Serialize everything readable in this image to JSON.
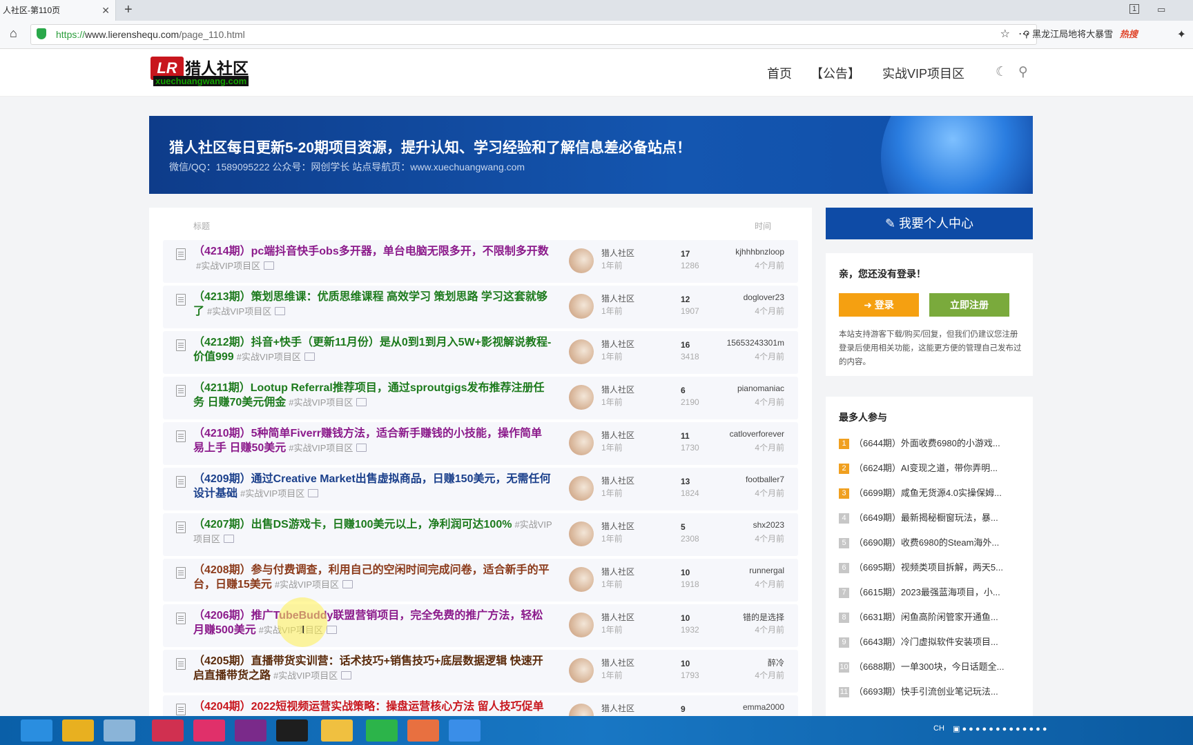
{
  "browser": {
    "tab_title": "人社区-第110页",
    "tab_close": "✕",
    "new_tab": "+",
    "url_scheme": "https://",
    "url_host": "www.lierenshequ.com",
    "url_path": "/page_110.html",
    "search_hint": "黑龙江局地将大暴雪",
    "search_hot": "热搜",
    "win_ctl_1": "1"
  },
  "site": {
    "logo_mark": "LR",
    "logo_name": "猎人社区",
    "logo_domain": "xuechuangwang.com",
    "nav": [
      "首页",
      "【公告】",
      "实战VIP项目区"
    ]
  },
  "banner": {
    "headline": "猎人社区每日更新5-20期项目资源，提升认知、学习经验和了解信息差必备站点！",
    "subline": "微信/QQ：1589095222 公众号：网创学长 站点导航页：www.xuechuangwang.com"
  },
  "list": {
    "col_title": "标题",
    "col_time": "时间",
    "rows": [
      {
        "title": "（4214期）pc端抖音快手obs多开器，单台电脑无限多开，不限制多开数",
        "category": "#实战VIP项目区",
        "color": "#8b1a8b",
        "author": "猎人社区",
        "ago": "1年前",
        "replies": "17",
        "views": "1286",
        "last_user": "kjhhhbnzloop",
        "last_ago": "4个月前"
      },
      {
        "title": "（4213期）策划思维课：优质思维课程 高效学习 策划思路 学习这套就够了",
        "category": "#实战VIP项目区",
        "color": "#1c7a1c",
        "author": "猎人社区",
        "ago": "1年前",
        "replies": "12",
        "views": "1907",
        "last_user": "doglover23",
        "last_ago": "4个月前"
      },
      {
        "title": "（4212期）抖音+快手（更新11月份）是从0到1到月入5W+影视解说教程-价值999",
        "category": "#实战VIP项目区",
        "color": "#1c7a1c",
        "author": "猎人社区",
        "ago": "1年前",
        "replies": "16",
        "views": "3418",
        "last_user": "15653243301m",
        "last_ago": "4个月前"
      },
      {
        "title": "（4211期）Lootup Referral推荐项目，通过sproutgigs发布推荐注册任务 日赚70美元佣金",
        "category": "#实战VIP项目区",
        "color": "#1c7a1c",
        "author": "猎人社区",
        "ago": "1年前",
        "replies": "6",
        "views": "2190",
        "last_user": "pianomaniac",
        "last_ago": "4个月前"
      },
      {
        "title": "（4210期）5种简单Fiverr赚钱方法，适合新手赚钱的小技能，操作简单易上手 日赚50美元",
        "category": "#实战VIP项目区",
        "color": "#8b1a8b",
        "author": "猎人社区",
        "ago": "1年前",
        "replies": "11",
        "views": "1730",
        "last_user": "catloverforever",
        "last_ago": "4个月前"
      },
      {
        "title": "（4209期）通过Creative Market出售虚拟商品，日赚150美元，无需任何设计基础",
        "category": "#实战VIP项目区",
        "color": "#1a3f8b",
        "author": "猎人社区",
        "ago": "1年前",
        "replies": "13",
        "views": "1824",
        "last_user": "footballer7",
        "last_ago": "4个月前"
      },
      {
        "title": "（4207期）出售DS游戏卡，日赚100美元以上，净利润可达100%",
        "category": "#实战VIP项目区",
        "color": "#1c7a1c",
        "author": "猎人社区",
        "ago": "1年前",
        "replies": "5",
        "views": "2308",
        "last_user": "shx2023",
        "last_ago": "4个月前"
      },
      {
        "title": "（4208期）参与付费调查，利用自己的空闲时间完成问卷，适合新手的平台，日赚15美元",
        "category": "#实战VIP项目区",
        "color": "#8b3a1a",
        "author": "猎人社区",
        "ago": "1年前",
        "replies": "10",
        "views": "1918",
        "last_user": "runnergal",
        "last_ago": "4个月前"
      },
      {
        "title": "（4206期）推广TubeBuddy联盟营销项目，完全免费的推广方法，轻松月赚500美元",
        "category": "#实战VIP项目区",
        "color": "#8b1a8b",
        "author": "猎人社区",
        "ago": "1年前",
        "replies": "10",
        "views": "1932",
        "last_user": "错的是选择",
        "last_ago": "4个月前"
      },
      {
        "title": "（4205期）直播带货实训营：话术技巧+销售技巧+底层数据逻辑 快速开启直播带货之路",
        "category": "#实战VIP项目区",
        "color": "#5a2a0a",
        "author": "猎人社区",
        "ago": "1年前",
        "replies": "10",
        "views": "1793",
        "last_user": "醉冷",
        "last_ago": "4个月前"
      },
      {
        "title": "（4204期）2022短视频运营实战策略：操盘运营核心方法 留人技巧促单",
        "category": "",
        "color": "#c8161d",
        "author": "猎人社区",
        "ago": "",
        "replies": "9",
        "views": "",
        "last_user": "emma2000",
        "last_ago": ""
      }
    ]
  },
  "sidebar": {
    "user_center": "我要个人中心",
    "greeting": "亲，您还没有登录！",
    "login": "登录",
    "register": "立即注册",
    "note": "本站支持游客下载/购买/回复，但我们仍建议您注册登录后使用相关功能，这能更方便的管理自己发布过的内容。",
    "hot_title": "最多人参与",
    "hot_items": [
      {
        "num": "1",
        "text": "（6644期）外面收费6980的小游戏...",
        "color": "#f0a020"
      },
      {
        "num": "2",
        "text": "（6624期）AI变现之道，带你弄明...",
        "color": "#f0a020"
      },
      {
        "num": "3",
        "text": "（6699期）咸鱼无货源4.0实操保姆...",
        "color": "#f0a020"
      },
      {
        "num": "4",
        "text": "（6649期）最新揭秘橱窗玩法，暴...",
        "color": "#c7c7c7"
      },
      {
        "num": "5",
        "text": "（6690期）收费6980的Steam海外...",
        "color": "#c7c7c7"
      },
      {
        "num": "6",
        "text": "（6695期）视频类项目拆解，两天5...",
        "color": "#c7c7c7"
      },
      {
        "num": "7",
        "text": "（6615期）2023最强蓝海项目，小...",
        "color": "#c7c7c7"
      },
      {
        "num": "8",
        "text": "（6631期）闲鱼高阶闲管家开通鱼...",
        "color": "#c7c7c7"
      },
      {
        "num": "9",
        "text": "（6643期）冷门虚拟软件安装项目...",
        "color": "#c7c7c7"
      },
      {
        "num": "10",
        "text": "（6688期）一单300块，今日话题全...",
        "color": "#c7c7c7"
      },
      {
        "num": "11",
        "text": "（6693期）快手引流创业笔记玩法...",
        "color": "#c7c7c7"
      }
    ]
  },
  "taskbar": {
    "lang": "CH"
  }
}
